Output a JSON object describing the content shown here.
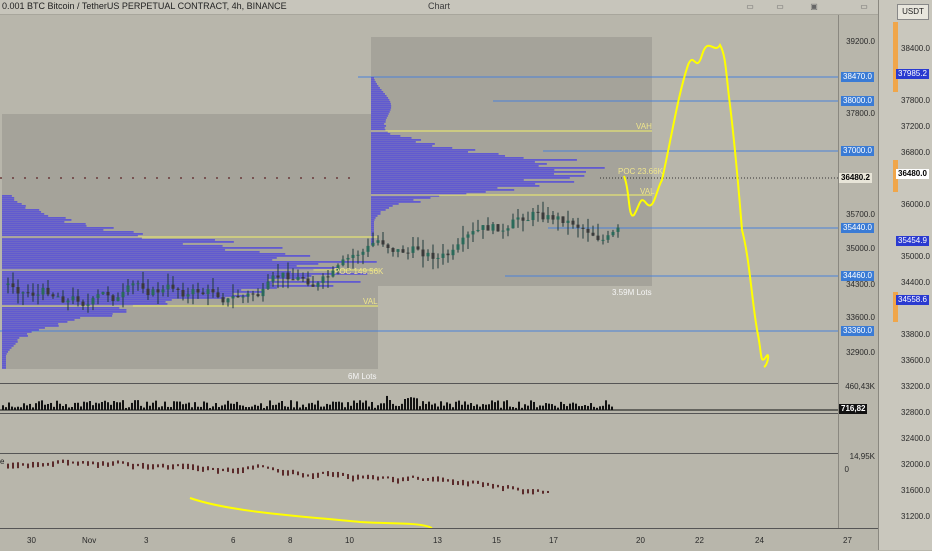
{
  "window": {
    "title": "Chart",
    "symbol": "0.001 BTC  Bitcoin / TetherUS PERPETUAL CONTRACT, 4h, BINANCE"
  },
  "profiles": [
    {
      "lots": "6M Lots",
      "val": "VAL",
      "poc": "POC 149.56K"
    },
    {
      "lots": "3.59M Lots",
      "vah": "VAH",
      "poc": "POC 23.66K",
      "val": "VAL"
    }
  ],
  "price_axis": {
    "ticks": [
      "39200.0",
      "38470.0",
      "38000.0",
      "37800.0",
      "37000.0",
      "36480.2",
      "35700.0",
      "35440.0",
      "35000.0",
      "34460.0",
      "34300.0",
      "33600.0",
      "33360.0",
      "32900.0"
    ],
    "levels": [
      "38470.0",
      "38000.0",
      "37000.0",
      "35440.0",
      "34460.0",
      "33360.0"
    ],
    "current": "36480.2"
  },
  "volume_axis": {
    "tick": "460,43K",
    "current": "716,82"
  },
  "osc_axis": {
    "tick": "14,95K",
    "zero": "0",
    "label": "e"
  },
  "right_panel": {
    "currency": "USDT",
    "ticks": [
      "38400.0",
      "37800.0",
      "37200.0",
      "36800.0",
      "36000.0",
      "35400.0",
      "35000.0",
      "34400.0",
      "33800.0",
      "33600.0",
      "33200.0",
      "32800.0",
      "32400.0",
      "32000.0",
      "31600.0",
      "31200.0"
    ],
    "label_high": "37985.2",
    "label_cur": "36480.0",
    "label_mid": "35454.9",
    "label_low": "34558.6"
  },
  "time_axis": [
    "30",
    "Nov",
    "3",
    "6",
    "8",
    "10",
    "13",
    "15",
    "17",
    "20",
    "22",
    "24",
    "27"
  ],
  "colors": {
    "bg": "#b8b6ab",
    "profile": "#5a52d6",
    "level_line": "#4a82d8",
    "value_line": "#f2f06a",
    "drawing": "#ffff00"
  }
}
